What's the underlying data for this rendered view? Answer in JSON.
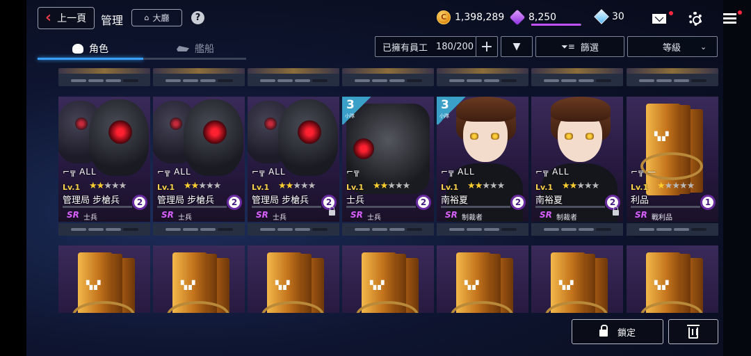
{
  "header": {
    "back_label": "上一頁",
    "title": "管理",
    "lobby_label": "大廳",
    "help_label": "?"
  },
  "currency": {
    "coins": "1,398,289",
    "gems": "8,250",
    "gem_fill": 0.98,
    "crystals": "30"
  },
  "tabs": [
    {
      "label": "角色",
      "active": true
    },
    {
      "label": "艦船",
      "active": false
    }
  ],
  "filters": {
    "employees_label": "已擁有員工",
    "employees_count": "180/200",
    "add_label": "+",
    "dropdown_label": "▼",
    "filter_label": "篩選",
    "sort_label": "等級"
  },
  "cards": [
    {
      "type": "trooper",
      "weapon": "ALL",
      "level": "Lv.1",
      "stars": 2,
      "max_stars": 5,
      "name": "管理局 步槍兵",
      "copies": "2",
      "rarity": "SR",
      "role": "士兵",
      "locked": false
    },
    {
      "type": "trooper",
      "weapon": "ALL",
      "level": "Lv.1",
      "stars": 2,
      "max_stars": 5,
      "name": "管理局 步槍兵",
      "copies": "2",
      "rarity": "SR",
      "role": "士兵",
      "locked": false
    },
    {
      "type": "trooper",
      "weapon": "ALL",
      "level": "Lv.1",
      "stars": 2,
      "max_stars": 5,
      "name": "管理局 步槍兵",
      "copies": "2",
      "rarity": "SR",
      "role": "士兵",
      "locked": true
    },
    {
      "type": "mech",
      "rank": "3",
      "rank_label": "小隊",
      "weapon": "",
      "level": "Lv.1",
      "stars": 2,
      "max_stars": 5,
      "name": "士兵",
      "copies": "2",
      "rarity": "SR",
      "role": "士兵",
      "locked": false
    },
    {
      "type": "girl",
      "rank": "3",
      "rank_label": "小隊",
      "weapon": "ALL",
      "level": "Lv.1",
      "stars": 2,
      "max_stars": 5,
      "name": "南裕夏",
      "copies": "2",
      "rarity": "SR",
      "role": "制裁者",
      "locked": false
    },
    {
      "type": "girl",
      "weapon": "ALL",
      "level": "Lv.1",
      "stars": 2,
      "max_stars": 5,
      "name": "南裕夏",
      "copies": "2",
      "rarity": "SR",
      "role": "制裁者",
      "locked": true
    },
    {
      "type": "box",
      "weapon": "—",
      "level": "Lv.1",
      "stars": 1,
      "max_stars": 5,
      "name": "利品",
      "copies": "1",
      "rarity": "SR",
      "role": "戰利品",
      "locked": false
    }
  ],
  "bottom": {
    "lock_label": "鎖定"
  },
  "colors": {
    "accent_blue": "#3aa0ff",
    "rarity_sr": "#d860ff",
    "star_on": "#ffcf2e",
    "level": "#ffd34a"
  }
}
